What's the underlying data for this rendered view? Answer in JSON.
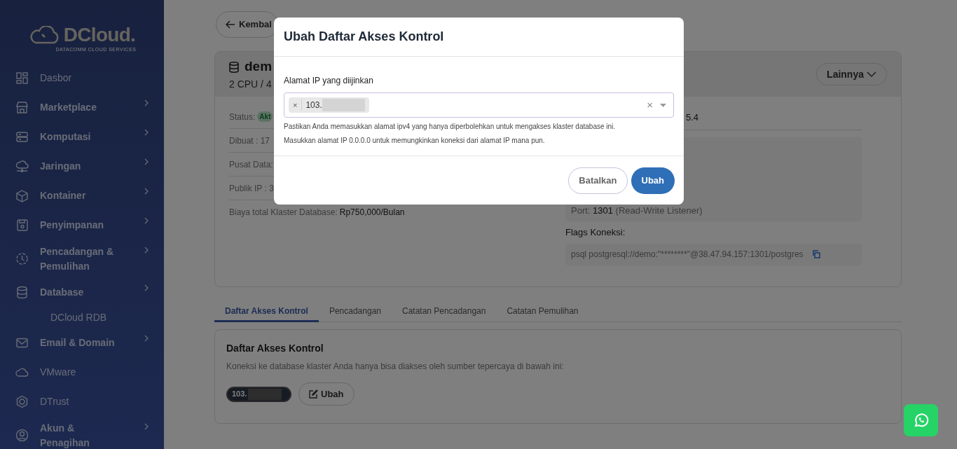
{
  "sidebar": {
    "logo": {
      "name": "DCloud.",
      "tagline": "DATACOMM CLOUD SERVICES"
    },
    "items": [
      {
        "label": "Dasbor",
        "expandable": false
      },
      {
        "label": "Marketplace",
        "expandable": true
      },
      {
        "label": "Komputasi",
        "expandable": true
      },
      {
        "label": "Jaringan",
        "expandable": true
      },
      {
        "label": "Kontainer",
        "expandable": true
      },
      {
        "label": "Penyimpanan",
        "expandable": true
      },
      {
        "label": "Pencadangan & Pemulihan",
        "expandable": true
      },
      {
        "label": "Database",
        "expandable": true,
        "children": [
          {
            "label": "DCloud RDB"
          }
        ]
      },
      {
        "label": "Email & Domain",
        "expandable": true
      },
      {
        "label": "VMware",
        "expandable": false
      },
      {
        "label": "DTrust",
        "expandable": false
      },
      {
        "label": "Akun & Penagihan",
        "expandable": true
      }
    ]
  },
  "back_button": "Kembal",
  "cluster": {
    "title": "dem",
    "subtitle": "2 CPU / 4",
    "more_button": "Lainnya",
    "details": [
      {
        "label": "Status:",
        "badge": "Akt"
      },
      {
        "label": "Dibuat : 17"
      },
      {
        "label": "Pusat Data:"
      },
      {
        "label": "Publik IP : 3"
      },
      {
        "label": "Biaya total Klaster Database:",
        "value": "Rp750,000/Bulan"
      }
    ],
    "version": "5.4",
    "port": {
      "label": "Port:",
      "value": "1301",
      "note": "(Read-Write Listener)"
    },
    "flags_label": "Flags Koneksi:",
    "flags_command": "psql postgresql://demo:\"********\"@38.47.94.157:1301/postgres"
  },
  "tabs": [
    {
      "label": "Daftar Akses Kontrol",
      "selected": true
    },
    {
      "label": "Pencadangan",
      "selected": false
    },
    {
      "label": "Catatan Pencadangan",
      "selected": false
    },
    {
      "label": "Catatan Pemulihan",
      "selected": false
    }
  ],
  "acl_panel": {
    "title": "Daftar Akses Kontrol",
    "description": "Koneksi ke database klaster Anda hanya bisa diakses oleh sumber tepercaya di bawah ini:",
    "ips": [
      "103."
    ],
    "edit_button": "Ubah"
  },
  "modal": {
    "title": "Ubah Daftar Akses Kontrol",
    "field_label": "Alamat IP yang diijinkan",
    "tags": [
      {
        "remove": "×",
        "value": "103."
      }
    ],
    "clear": "×",
    "help": [
      "Pastikan Anda memasukkan alamat ipv4 yang hanya diperbolehkan untuk mengakses klaster database ini.",
      "Masukkan alamat IP 0.0.0.0 untuk memungkinkan koneksi dari alamat IP mana pun."
    ],
    "cancel_button": "Batalkan",
    "submit_button": "Ubah"
  }
}
